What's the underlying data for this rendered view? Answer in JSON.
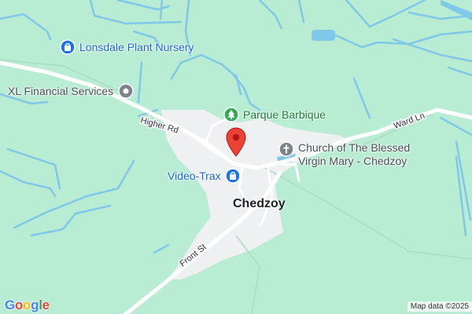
{
  "map": {
    "town": "Chedzoy",
    "places": [
      {
        "name": "Lonsdale Plant Nursery",
        "icon": "shopping-bag-icon",
        "color": "#1a73e8"
      },
      {
        "name": "XL Financial Services",
        "icon": "place-icon",
        "color": "#7c8489"
      },
      {
        "name": "Parque Barbique",
        "icon": "tree-icon",
        "color": "#34a853"
      },
      {
        "name": "Church of The Blessed",
        "name_line2": "Virgin Mary - Chedzoy",
        "icon": "church-cross-icon",
        "color": "#7c8489"
      },
      {
        "name": "Video-Trax",
        "icon": "shopping-bag-icon",
        "color": "#1a73e8"
      }
    ],
    "roads": [
      "Higher Rd",
      "Ward Ln",
      "Front St"
    ],
    "marker": {
      "icon": "location-pin-icon",
      "color": "#ea4335"
    }
  },
  "footer": {
    "logo": [
      "G",
      "o",
      "o",
      "g",
      "l",
      "e"
    ],
    "logo_colors": [
      "#4285f4",
      "#ea4335",
      "#fbbc05",
      "#4285f4",
      "#34a853",
      "#ea4335"
    ],
    "attribution": "Map data ©2025"
  }
}
